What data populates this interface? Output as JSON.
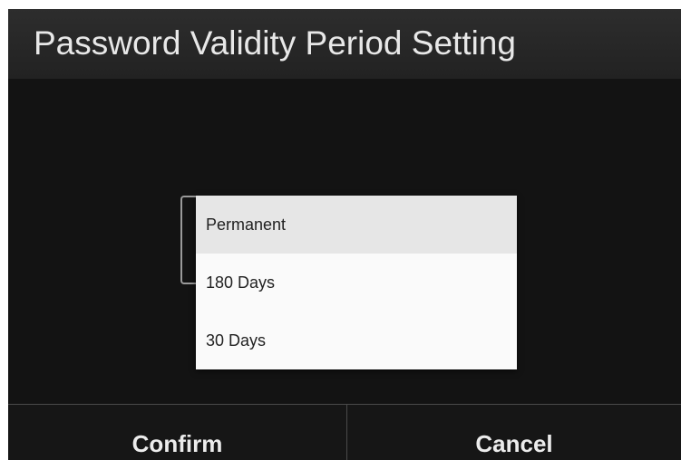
{
  "dialog": {
    "title": "Password Validity Period Setting"
  },
  "dropdown": {
    "selected": "Permanent",
    "options": [
      "Permanent",
      "180 Days",
      "30 Days"
    ]
  },
  "buttons": {
    "confirm_label": "Confirm",
    "cancel_label": "Cancel"
  }
}
